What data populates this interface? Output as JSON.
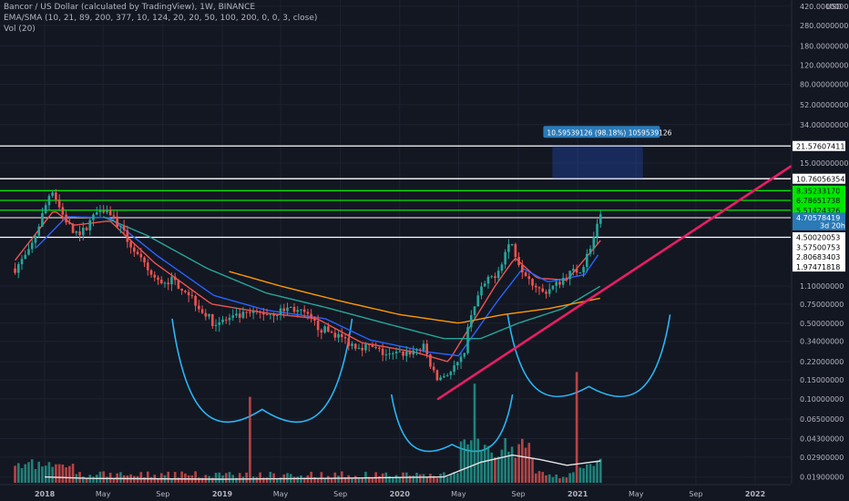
{
  "header": {
    "title": "Bancor / US Dollar (calculated by TradingView), 1W, BINANCE",
    "indicator": "EMA/SMA (10, 21, 89, 200, 377, 10, 124, 20, 20, 50, 100, 200, 0, 0, 3, close)",
    "volume": "Vol (20)"
  },
  "chart_data": {
    "type": "candlestick",
    "symbol": "BNT/USD",
    "interval": "1W",
    "scale": "log",
    "price_unit": "USD",
    "price_axis": {
      "range": [
        0.0165,
        480
      ],
      "ticks": [
        {
          "v": 420,
          "label": "420.0000000"
        },
        {
          "v": 280,
          "label": "280.0000000"
        },
        {
          "v": 180,
          "label": "180.0000000"
        },
        {
          "v": 120,
          "label": "120.0000000"
        },
        {
          "v": 80,
          "label": "80.00000000"
        },
        {
          "v": 52,
          "label": "52.00000000"
        },
        {
          "v": 34,
          "label": "34.00000000"
        },
        {
          "v": 15,
          "label": "15.00000000"
        },
        {
          "v": 1.1,
          "label": "1.10000000"
        },
        {
          "v": 0.75,
          "label": "0.75000000"
        },
        {
          "v": 0.5,
          "label": "0.50000000"
        },
        {
          "v": 0.34,
          "label": "0.34000000"
        },
        {
          "v": 0.22,
          "label": "0.22000000"
        },
        {
          "v": 0.15,
          "label": "0.15000000"
        },
        {
          "v": 0.1,
          "label": "0.10000000"
        },
        {
          "v": 0.065,
          "label": "0.06500000"
        },
        {
          "v": 0.043,
          "label": "0.04300000"
        },
        {
          "v": 0.029,
          "label": "0.02900000"
        },
        {
          "v": 0.019,
          "label": "0.01900000"
        }
      ]
    },
    "time_axis": {
      "range": [
        "2017-10-01",
        "2022-03-15"
      ],
      "ticks": [
        {
          "date": "2018-01-01",
          "label": "2018",
          "bold": true
        },
        {
          "date": "2018-05-01",
          "label": "May"
        },
        {
          "date": "2018-09-01",
          "label": "Sep"
        },
        {
          "date": "2019-01-01",
          "label": "2019",
          "bold": true
        },
        {
          "date": "2019-05-01",
          "label": "May"
        },
        {
          "date": "2019-09-01",
          "label": "Sep"
        },
        {
          "date": "2020-01-01",
          "label": "2020",
          "bold": true
        },
        {
          "date": "2020-05-01",
          "label": "May"
        },
        {
          "date": "2020-09-01",
          "label": "Sep"
        },
        {
          "date": "2021-01-01",
          "label": "2021",
          "bold": true
        },
        {
          "date": "2021-05-01",
          "label": "May"
        },
        {
          "date": "2021-09-01",
          "label": "Sep"
        },
        {
          "date": "2022-01-01",
          "label": "2022",
          "bold": true
        }
      ]
    },
    "price_path": [
      [
        "2017-11-01",
        1.6
      ],
      [
        "2017-12-01",
        2.3
      ],
      [
        "2018-01-05",
        6.5
      ],
      [
        "2018-01-15",
        9.0
      ],
      [
        "2018-02-05",
        5.2
      ],
      [
        "2018-03-01",
        3.4
      ],
      [
        "2018-03-20",
        3.5
      ],
      [
        "2018-04-25",
        6.0
      ],
      [
        "2018-05-15",
        5.3
      ],
      [
        "2018-06-15",
        3.2
      ],
      [
        "2018-07-20",
        1.8
      ],
      [
        "2018-08-20",
        1.2
      ],
      [
        "2018-09-20",
        1.25
      ],
      [
        "2018-10-20",
        1.0
      ],
      [
        "2018-11-25",
        0.62
      ],
      [
        "2018-12-15",
        0.5
      ],
      [
        "2019-01-20",
        0.55
      ],
      [
        "2019-02-20",
        0.6
      ],
      [
        "2019-03-20",
        0.62
      ],
      [
        "2019-04-20",
        0.62
      ],
      [
        "2019-05-20",
        0.7
      ],
      [
        "2019-06-20",
        0.6
      ],
      [
        "2019-07-20",
        0.45
      ],
      [
        "2019-08-20",
        0.4
      ],
      [
        "2019-09-25",
        0.32
      ],
      [
        "2019-11-01",
        0.3
      ],
      [
        "2019-12-10",
        0.25
      ],
      [
        "2020-01-20",
        0.27
      ],
      [
        "2020-02-20",
        0.3
      ],
      [
        "2020-03-16",
        0.15
      ],
      [
        "2020-04-15",
        0.18
      ],
      [
        "2020-05-10",
        0.24
      ],
      [
        "2020-05-25",
        0.6
      ],
      [
        "2020-06-20",
        1.1
      ],
      [
        "2020-07-20",
        1.5
      ],
      [
        "2020-08-15",
        2.9
      ],
      [
        "2020-09-05",
        1.7
      ],
      [
        "2020-10-01",
        1.2
      ],
      [
        "2020-10-20",
        0.95
      ],
      [
        "2020-11-15",
        1.1
      ],
      [
        "2020-12-10",
        1.4
      ],
      [
        "2021-01-10",
        1.6
      ],
      [
        "2021-02-01",
        2.9
      ],
      [
        "2021-02-17",
        4.7
      ]
    ],
    "moving_averages": [
      {
        "name": "EMA fast",
        "color": "#ef5350",
        "path": [
          [
            "2017-11-01",
            1.9
          ],
          [
            "2018-01-20",
            5.5
          ],
          [
            "2018-03-01",
            4.0
          ],
          [
            "2018-05-15",
            4.4
          ],
          [
            "2018-08-15",
            1.8
          ],
          [
            "2018-12-10",
            0.75
          ],
          [
            "2019-04-01",
            0.62
          ],
          [
            "2019-07-15",
            0.55
          ],
          [
            "2019-10-15",
            0.33
          ],
          [
            "2020-02-01",
            0.27
          ],
          [
            "2020-04-10",
            0.22
          ],
          [
            "2020-07-15",
            1.1
          ],
          [
            "2020-08-25",
            2.0
          ],
          [
            "2020-10-10",
            1.3
          ],
          [
            "2020-12-10",
            1.25
          ],
          [
            "2021-02-17",
            2.9
          ]
        ]
      },
      {
        "name": "EMA slow",
        "color": "#2962ff",
        "path": [
          [
            "2017-12-15",
            2.5
          ],
          [
            "2018-02-15",
            4.8
          ],
          [
            "2018-05-15",
            4.7
          ],
          [
            "2018-08-20",
            2.1
          ],
          [
            "2018-12-15",
            0.9
          ],
          [
            "2019-04-01",
            0.66
          ],
          [
            "2019-08-01",
            0.55
          ],
          [
            "2019-11-01",
            0.35
          ],
          [
            "2020-03-01",
            0.27
          ],
          [
            "2020-05-01",
            0.25
          ],
          [
            "2020-07-20",
            0.8
          ],
          [
            "2020-09-10",
            1.6
          ],
          [
            "2020-11-01",
            1.2
          ],
          [
            "2021-01-15",
            1.4
          ],
          [
            "2021-02-17",
            2.3
          ]
        ]
      },
      {
        "name": "EMA 89",
        "color": "#26a69a",
        "path": [
          [
            "2018-05-01",
            4.8
          ],
          [
            "2018-08-01",
            3.2
          ],
          [
            "2018-12-01",
            1.6
          ],
          [
            "2019-04-01",
            0.95
          ],
          [
            "2019-08-01",
            0.7
          ],
          [
            "2019-12-01",
            0.5
          ],
          [
            "2020-04-01",
            0.36
          ],
          [
            "2020-06-15",
            0.36
          ],
          [
            "2020-09-01",
            0.5
          ],
          [
            "2020-12-01",
            0.68
          ],
          [
            "2021-02-17",
            1.1
          ]
        ]
      },
      {
        "name": "SMA 124",
        "color": "#ff9800",
        "path": [
          [
            "2019-01-15",
            1.5
          ],
          [
            "2019-05-01",
            1.1
          ],
          [
            "2019-09-01",
            0.8
          ],
          [
            "2020-01-01",
            0.6
          ],
          [
            "2020-05-01",
            0.5
          ],
          [
            "2020-08-01",
            0.6
          ],
          [
            "2020-11-01",
            0.68
          ],
          [
            "2021-02-17",
            0.85
          ]
        ]
      }
    ],
    "volume": {
      "average_line_color": "#e6e6e6",
      "spikes": [
        {
          "date": "2019-02-25",
          "value": 118
        },
        {
          "date": "2020-06-05",
          "value": 136
        },
        {
          "date": "2020-12-28",
          "value": 152
        }
      ]
    },
    "horizontal_levels": [
      {
        "price": 21.57607411,
        "label": "21.57607411",
        "color": "#ffffff",
        "label_style": "white"
      },
      {
        "price": 10.76056354,
        "label": "10.76056354",
        "color": "#ffffff",
        "label_style": "white"
      },
      {
        "price": 8.3523317,
        "label": "8.35233170",
        "color": "#00e600",
        "label_style": "green"
      },
      {
        "price": 6.78651738,
        "label": "6.78651738",
        "color": "#00e600",
        "label_style": "green"
      },
      {
        "price": 5.51424326,
        "label": "5.51424326",
        "color": "#00e600",
        "label_style": "green"
      },
      {
        "price": 4.70578419,
        "label": "4.70578419",
        "color": "#ffffff",
        "label_style": "price"
      },
      {
        "price": 4.0,
        "label": "3d 20h",
        "color": "#ffffff",
        "label_style": "countdown"
      },
      {
        "price": 3.1,
        "label": "4.50020053",
        "color": "#ffffff",
        "label_style": "white"
      },
      {
        "price": 2.08,
        "label": "3.57500753",
        "color": "#ffffff",
        "label_style": "white"
      },
      {
        "price": 2.08,
        "label": "2.80683403",
        "color": "#ffffff",
        "label_style": "white"
      },
      {
        "price": 2.08,
        "label": "1.97471818",
        "color": "#ffffff",
        "label_style": "white"
      }
    ],
    "trendline": {
      "color": "#e91e63",
      "from": [
        "2020-03-20",
        0.1
      ],
      "to": [
        "2022-03-15",
        14
      ]
    },
    "measure_box": {
      "label": "10.59539126 (98.18%) 1059539126",
      "date_from": "2020-11-10",
      "date_to": "2021-05-15",
      "price_from": 10.76,
      "price_to": 21.58,
      "color": "#2962ff"
    },
    "pattern_arcs": [
      {
        "color": "#29b6f6",
        "date_from": "2018-09-20",
        "date_to": "2019-09-25",
        "price_bottom": 0.08,
        "price_top": 0.55
      },
      {
        "color": "#29b6f6",
        "date_from": "2019-12-15",
        "date_to": "2020-08-20",
        "price_bottom": 0.038,
        "price_top": 0.11
      },
      {
        "color": "#29b6f6",
        "date_from": "2020-08-10",
        "date_to": "2021-07-10",
        "price_bottom": 0.13,
        "price_top": 0.6
      }
    ]
  }
}
